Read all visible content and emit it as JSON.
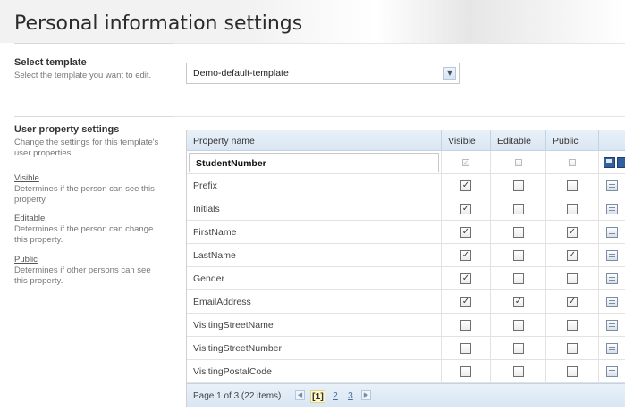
{
  "page": {
    "title": "Personal information settings"
  },
  "select_template": {
    "heading": "Select template",
    "description": "Select the template you want to edit.",
    "selected_value": "Demo-default-template"
  },
  "user_property_settings": {
    "heading": "User property settings",
    "description": "Change the settings for this template's user properties.",
    "legend": [
      {
        "term": "Visible",
        "description": "Determines if the person can see this property."
      },
      {
        "term": "Editable",
        "description": "Determines if the person can change this property."
      },
      {
        "term": "Public",
        "description": "Determines if other persons can see this property."
      }
    ]
  },
  "grid": {
    "columns": [
      "Property name",
      "Visible",
      "Editable",
      "Public"
    ],
    "editing_row": {
      "property": "StudentNumber",
      "visible": true,
      "editable": false,
      "public": false
    },
    "rows": [
      {
        "property": "Prefix",
        "visible": true,
        "editable": false,
        "public": false
      },
      {
        "property": "Initials",
        "visible": true,
        "editable": false,
        "public": false
      },
      {
        "property": "FirstName",
        "visible": true,
        "editable": false,
        "public": true
      },
      {
        "property": "LastName",
        "visible": true,
        "editable": false,
        "public": true
      },
      {
        "property": "Gender",
        "visible": true,
        "editable": false,
        "public": false
      },
      {
        "property": "EmailAddress",
        "visible": true,
        "editable": true,
        "public": true
      },
      {
        "property": "VisitingStreetName",
        "visible": false,
        "editable": false,
        "public": false
      },
      {
        "property": "VisitingStreetNumber",
        "visible": false,
        "editable": false,
        "public": false
      },
      {
        "property": "VisitingPostalCode",
        "visible": false,
        "editable": false,
        "public": false
      }
    ],
    "pager": {
      "info": "Page 1 of 3 (22 items)",
      "pages": [
        "[1]",
        "2",
        "3"
      ]
    }
  }
}
